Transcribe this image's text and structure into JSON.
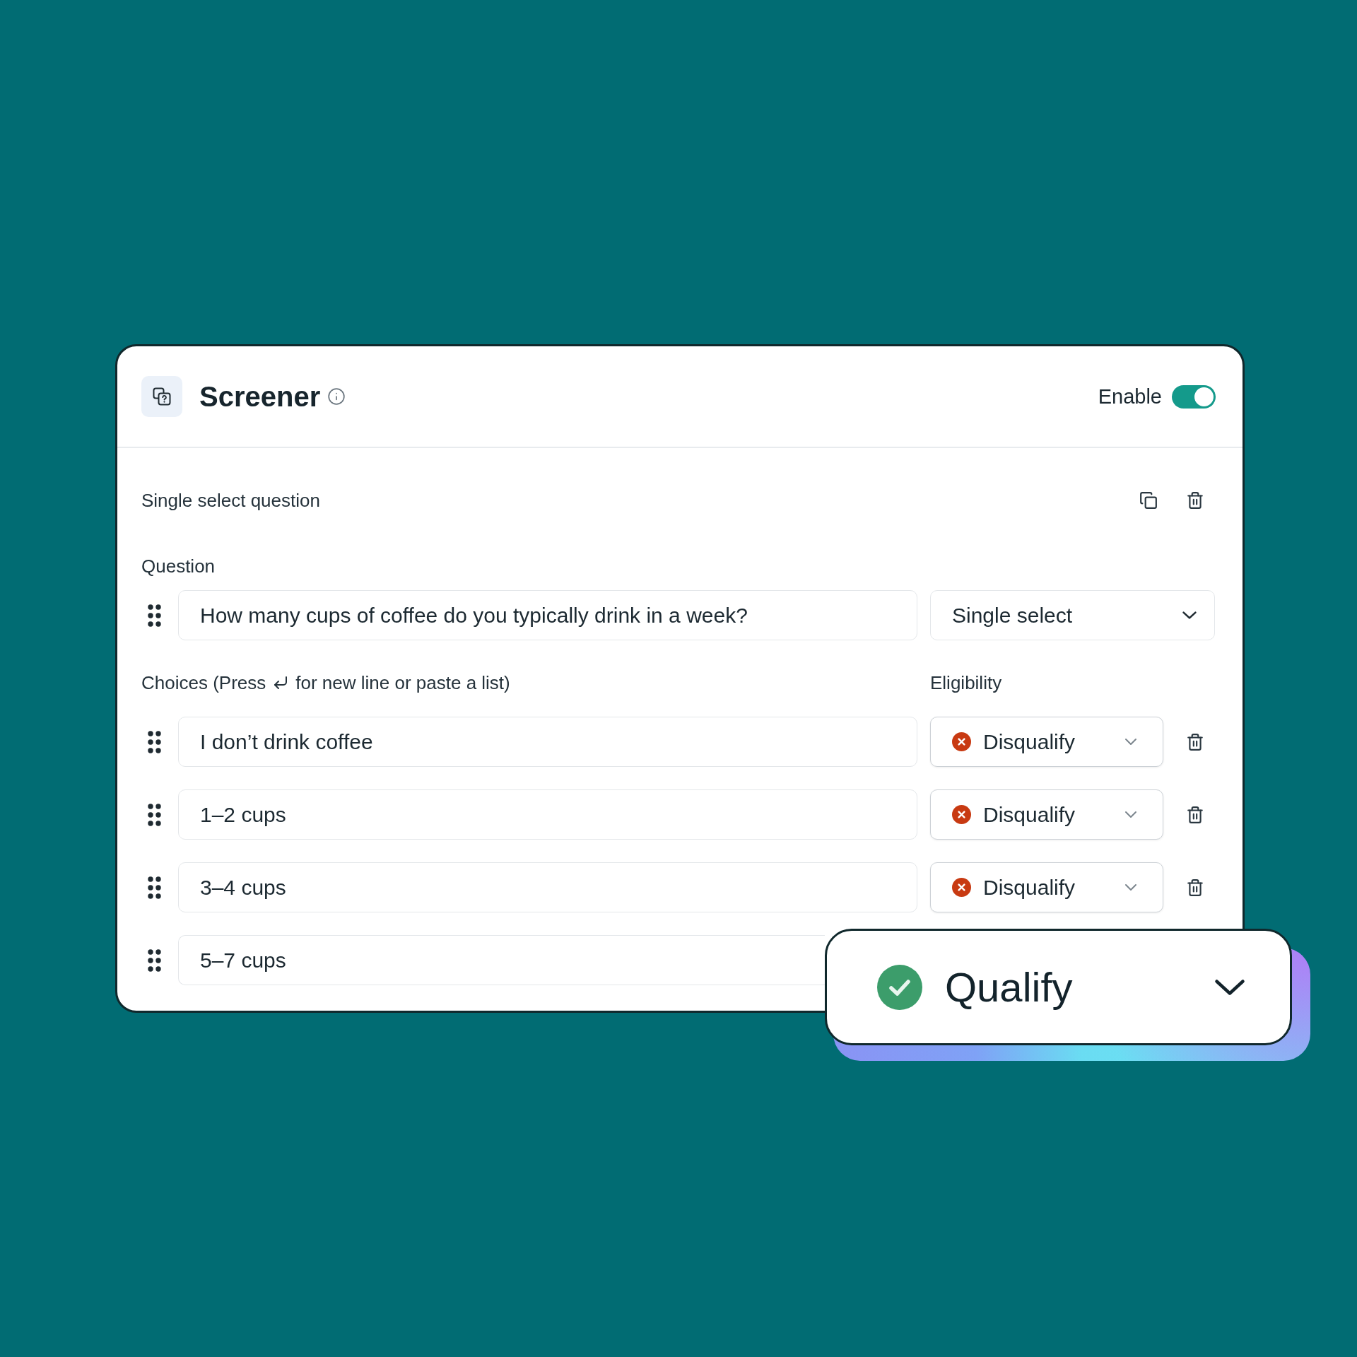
{
  "header": {
    "title": "Screener",
    "enable_label": "Enable",
    "enabled": true
  },
  "question_section": {
    "heading": "Single select question",
    "question_label": "Question",
    "question": "How many cups of coffee do you typically drink in a week?",
    "question_type": "Single select"
  },
  "choices_header": {
    "label_before_key": "Choices (Press",
    "label_after_key": "for new line or paste a list)",
    "eligibility_label": "Eligibility"
  },
  "choices": [
    {
      "text": "I don’t drink coffee",
      "eligibility": {
        "label": "Disqualify",
        "kind": "disqualify"
      }
    },
    {
      "text": "1–2 cups",
      "eligibility": {
        "label": "Disqualify",
        "kind": "disqualify"
      }
    },
    {
      "text": "3–4 cups",
      "eligibility": {
        "label": "Disqualify",
        "kind": "disqualify"
      }
    },
    {
      "text": "5–7 cups"
    }
  ],
  "callout_select": {
    "label": "Qualify",
    "kind": "qualify"
  }
}
